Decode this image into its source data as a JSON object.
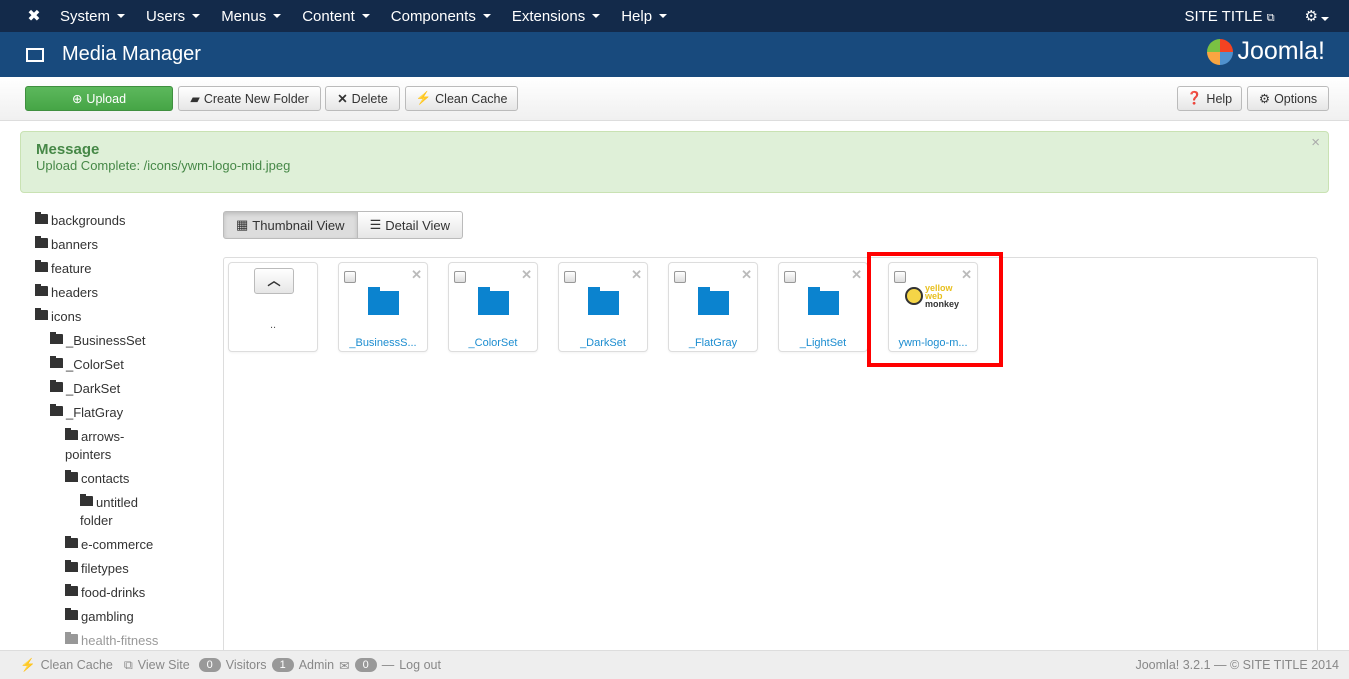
{
  "nav": {
    "items": [
      "System",
      "Users",
      "Menus",
      "Content",
      "Components",
      "Extensions",
      "Help"
    ],
    "site_title": "SITE TITLE"
  },
  "header": {
    "title": "Media Manager",
    "brand": "Joomla!"
  },
  "toolbar": {
    "upload": "Upload",
    "new_folder": "Create New Folder",
    "delete": "Delete",
    "clean_cache": "Clean Cache",
    "help": "Help",
    "options": "Options"
  },
  "message": {
    "heading": "Message",
    "text": "Upload Complete: /icons/ywm-logo-mid.jpeg"
  },
  "tree": [
    {
      "label": "backgrounds",
      "level": 0
    },
    {
      "label": "banners",
      "level": 0
    },
    {
      "label": "feature",
      "level": 0
    },
    {
      "label": "headers",
      "level": 0
    },
    {
      "label": "icons",
      "level": 0
    },
    {
      "label": "_BusinessSet",
      "level": 1
    },
    {
      "label": "_ColorSet",
      "level": 1
    },
    {
      "label": "_DarkSet",
      "level": 1
    },
    {
      "label": "_FlatGray",
      "level": 1
    },
    {
      "label": "arrows-pointers",
      "level": 2
    },
    {
      "label": "contacts",
      "level": 2
    },
    {
      "label": "untitled folder",
      "level": 3
    },
    {
      "label": "e-commerce",
      "level": 2
    },
    {
      "label": "filetypes",
      "level": 2
    },
    {
      "label": "food-drinks",
      "level": 2
    },
    {
      "label": "gambling",
      "level": 2
    },
    {
      "label": "health-fitness",
      "level": 2
    }
  ],
  "views": {
    "thumbnail": "Thumbnail View",
    "detail": "Detail View"
  },
  "up_label": "..",
  "thumbs": [
    "_BusinessS...",
    "_ColorSet",
    "_DarkSet",
    "_FlatGray",
    "_LightSet"
  ],
  "image_thumb": {
    "label": "ywm-logo-m...",
    "logo_text": "yellow web monkey"
  },
  "footer": {
    "clean_cache": "Clean Cache",
    "view_site": "View Site",
    "visitors_count": "0",
    "visitors": "Visitors",
    "admin_count": "1",
    "admin": "Admin",
    "messages_count": "0",
    "logout": "Log out",
    "version": "Joomla! 3.2.1 — © SITE TITLE 2014"
  },
  "colors": {
    "navbar": "#132a4a",
    "header": "#184a7d",
    "success": "#46a546",
    "folder": "#0b83cf",
    "highlight": "#ff0000"
  }
}
